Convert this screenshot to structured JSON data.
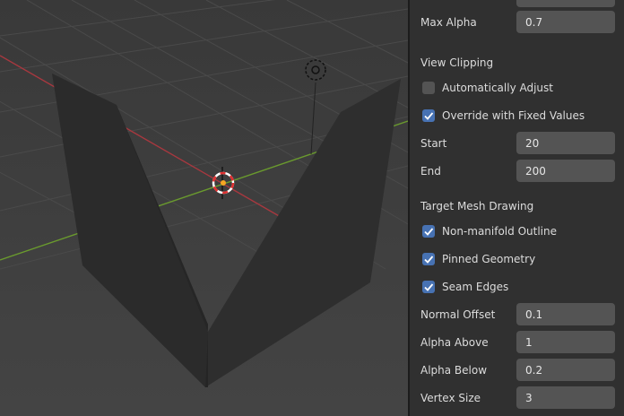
{
  "viewport": {
    "objects": [
      "v-shaped-mesh",
      "3d-cursor",
      "light-object"
    ]
  },
  "panel": {
    "max_alpha": {
      "label": "Max Alpha",
      "value": "0.7"
    },
    "view_clipping": {
      "heading": "View Clipping",
      "auto_adjust": {
        "label": "Automatically Adjust",
        "checked": false
      },
      "override_fixed": {
        "label": "Override with Fixed Values",
        "checked": true
      },
      "start": {
        "label": "Start",
        "value": "20"
      },
      "end": {
        "label": "End",
        "value": "200"
      }
    },
    "target_mesh": {
      "heading": "Target Mesh Drawing",
      "non_manifold": {
        "label": "Non-manifold Outline",
        "checked": true
      },
      "pinned": {
        "label": "Pinned Geometry",
        "checked": true
      },
      "seam": {
        "label": "Seam Edges",
        "checked": true
      },
      "normal_offset": {
        "label": "Normal Offset",
        "value": "0.1"
      },
      "alpha_above": {
        "label": "Alpha Above",
        "value": "1"
      },
      "alpha_below": {
        "label": "Alpha Below",
        "value": "0.2"
      },
      "vertex_size": {
        "label": "Vertex Size",
        "value": "3"
      }
    }
  },
  "colors": {
    "checkbox_on": "#4772b3",
    "field_bg": "#545454",
    "panel_bg": "#303030",
    "viewport_bg": "#3d3d3d",
    "x_axis": "#a8383f",
    "y_axis": "#6a9a2e"
  }
}
